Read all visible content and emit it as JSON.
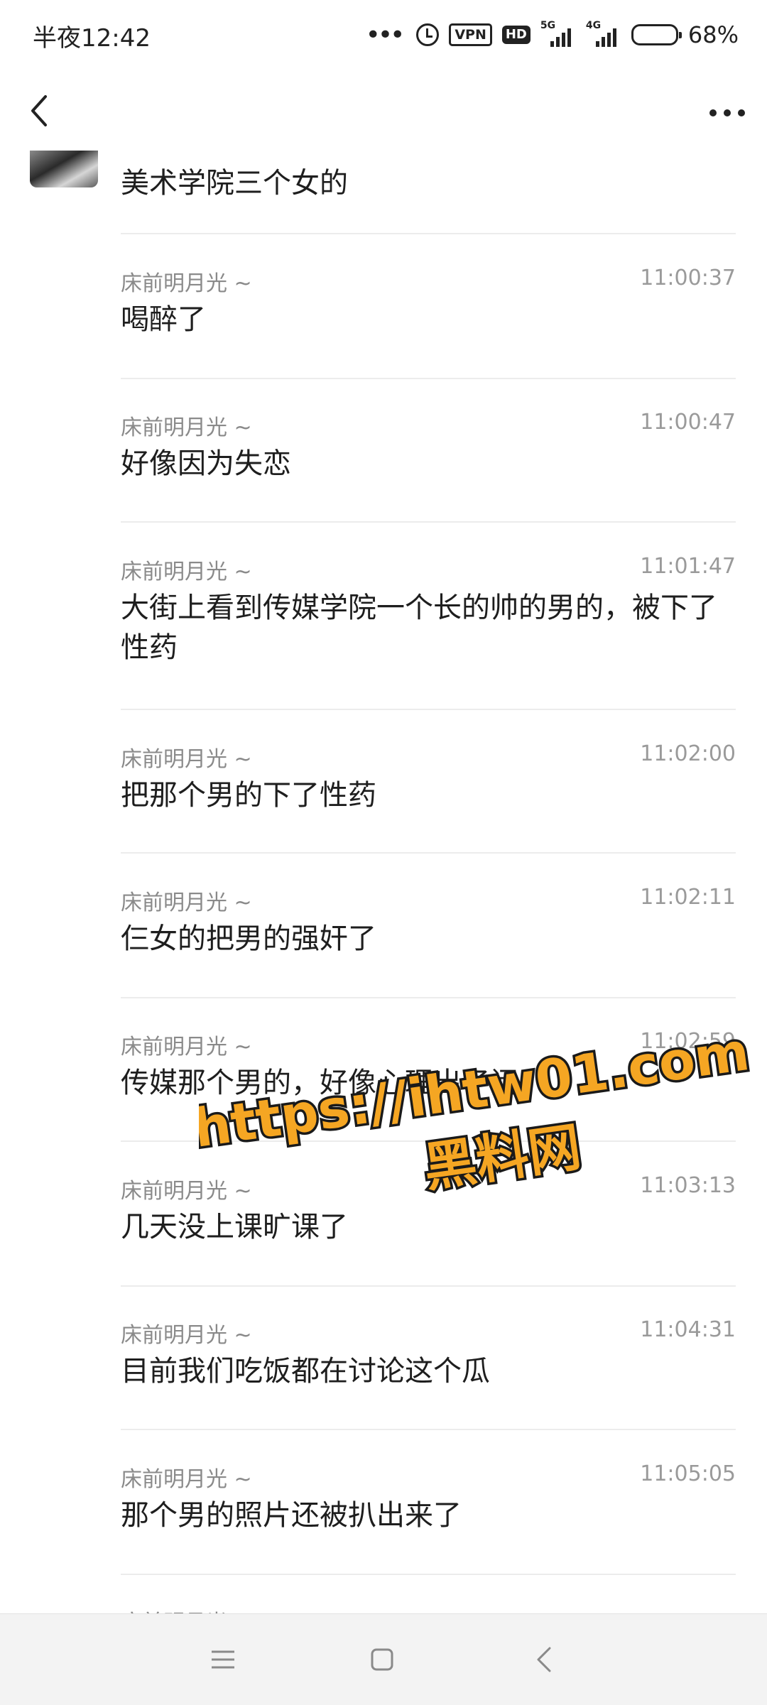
{
  "status_bar": {
    "time": "半夜12:42",
    "vpn": "VPN",
    "hd": "HD",
    "signal_1": "5G",
    "signal_2": "4G",
    "battery": "68%",
    "battery_level": 0.68
  },
  "first_message": {
    "body": "美术学院三个女的"
  },
  "messages": [
    {
      "sender": "床前明月光 ~",
      "time": "11:00:37",
      "body": "喝醉了"
    },
    {
      "sender": "床前明月光 ~",
      "time": "11:00:47",
      "body": "好像因为失恋"
    },
    {
      "sender": "床前明月光 ~",
      "time": "11:01:47",
      "body": "大街上看到传媒学院一个长的帅的男的，被下了性药"
    },
    {
      "sender": "床前明月光 ~",
      "time": "11:02:00",
      "body": "把那个男的下了性药"
    },
    {
      "sender": "床前明月光 ~",
      "time": "11:02:11",
      "body": "仨女的把男的强奸了"
    },
    {
      "sender": "床前明月光 ~",
      "time": "11:02:59",
      "body": "传媒那个男的，好像心理出了问"
    },
    {
      "sender": "床前明月光 ~",
      "time": "11:03:13",
      "body": "几天没上课旷课了"
    },
    {
      "sender": "床前明月光 ~",
      "time": "11:04:31",
      "body": "目前我们吃饭都在讨论这个瓜"
    },
    {
      "sender": "床前明月光 ~",
      "time": "11:05:05",
      "body": "那个男的照片还被扒出来了"
    }
  ],
  "cut_off_sender": "床前明月光 ~",
  "watermark": {
    "url": "https://ihtw01.com",
    "name": "黑料网",
    "fill": "#f5a623",
    "outline": "#1a1a1a"
  },
  "icons": {
    "back": "chevron-left-icon",
    "more": "more-horizontal-icon",
    "nav_menu": "menu-icon",
    "nav_home": "home-square-icon",
    "nav_back": "back-triangle-icon"
  }
}
